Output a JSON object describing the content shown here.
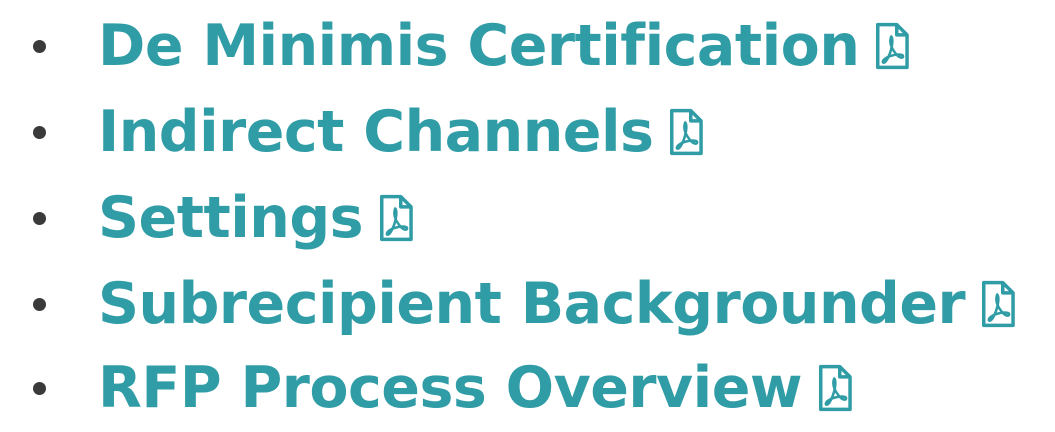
{
  "colors": {
    "link": "#2f9ca6",
    "bullet": "#3a3a3a",
    "background": "#ffffff"
  },
  "documents": [
    {
      "label": "De Minimis Certification",
      "icon": "pdf-file-icon"
    },
    {
      "label": "Indirect Channels",
      "icon": "pdf-file-icon"
    },
    {
      "label": "Settings",
      "icon": "pdf-file-icon"
    },
    {
      "label": "Subrecipient Backgrounder",
      "icon": "pdf-file-icon"
    },
    {
      "label": "RFP Process Overview",
      "icon": "pdf-file-icon"
    }
  ]
}
